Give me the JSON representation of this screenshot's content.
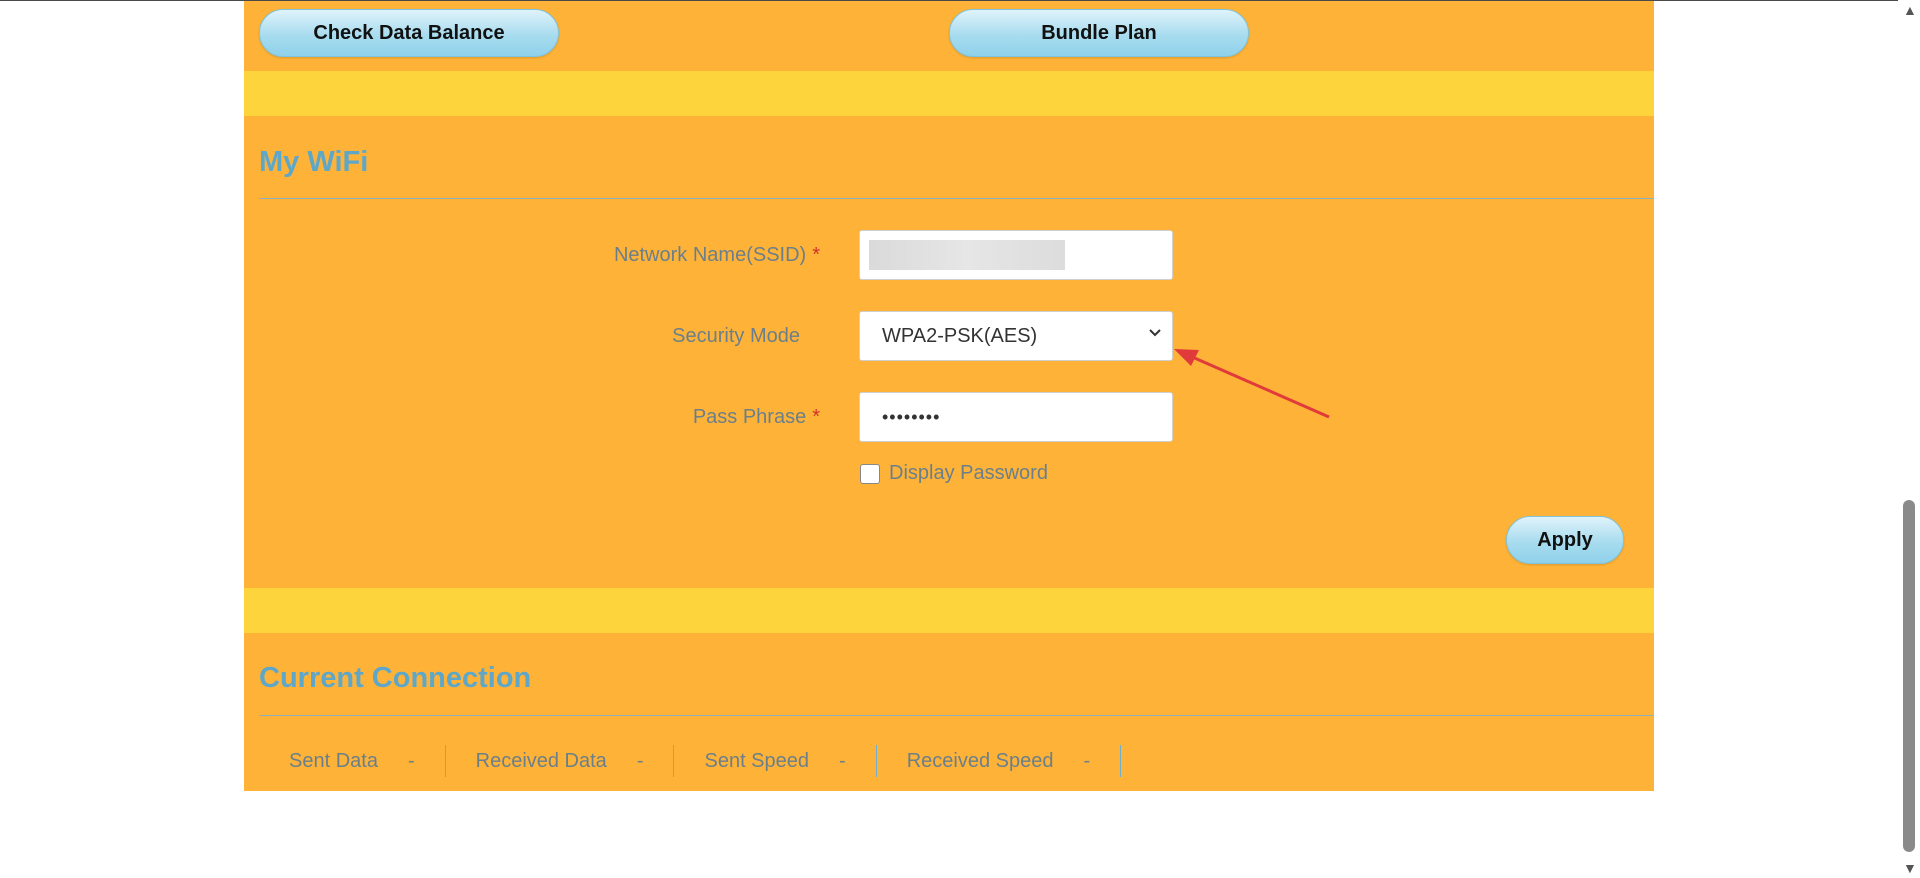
{
  "top_buttons": {
    "check_balance": "Check Data Balance",
    "bundle_plan": "Bundle Plan"
  },
  "wifi": {
    "title": "My WiFi",
    "ssid_label": "Network Name(SSID)",
    "required_mark": "*",
    "security_label": "Security Mode",
    "security_value": "WPA2-PSK(AES)",
    "pass_label": "Pass Phrase",
    "pass_value": "••••••••",
    "display_password_label": "Display Password",
    "apply_label": "Apply"
  },
  "connection": {
    "title": "Current Connection",
    "stats": [
      {
        "label": "Sent Data",
        "value": "-"
      },
      {
        "label": "Received Data",
        "value": "-"
      },
      {
        "label": "Sent Speed",
        "value": "-"
      },
      {
        "label": "Received Speed",
        "value": "-"
      }
    ]
  },
  "icons": {
    "select_chevron": "chevron-down-icon",
    "annotation": "red-arrow"
  },
  "colors": {
    "panel": "#feb338",
    "band": "#fed43c",
    "title": "#5ea7c9",
    "required": "#d0312d",
    "annotation": "#e03a3a"
  }
}
